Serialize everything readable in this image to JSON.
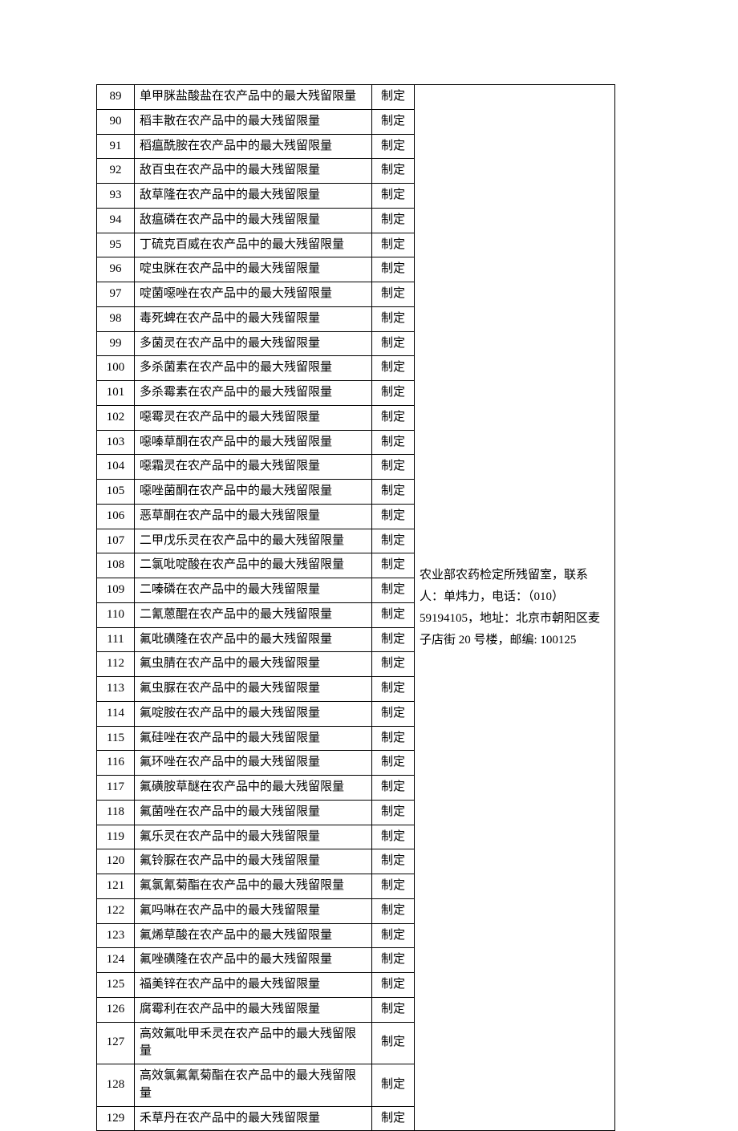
{
  "rows": [
    {
      "no": "89",
      "name": "单甲脒盐酸盐在农产品中的最大残留限量",
      "status": "制定"
    },
    {
      "no": "90",
      "name": "稻丰散在农产品中的最大残留限量",
      "status": "制定"
    },
    {
      "no": "91",
      "name": "稻瘟酰胺在农产品中的最大残留限量",
      "status": "制定"
    },
    {
      "no": "92",
      "name": "敌百虫在农产品中的最大残留限量",
      "status": "制定"
    },
    {
      "no": "93",
      "name": "敌草隆在农产品中的最大残留限量",
      "status": "制定"
    },
    {
      "no": "94",
      "name": "敌瘟磷在农产品中的最大残留限量",
      "status": "制定"
    },
    {
      "no": "95",
      "name": "丁硫克百威在农产品中的最大残留限量",
      "status": "制定"
    },
    {
      "no": "96",
      "name": "啶虫脒在农产品中的最大残留限量",
      "status": "制定"
    },
    {
      "no": "97",
      "name": "啶菌噁唑在农产品中的最大残留限量",
      "status": "制定"
    },
    {
      "no": "98",
      "name": "毒死蜱在农产品中的最大残留限量",
      "status": "制定"
    },
    {
      "no": "99",
      "name": "多菌灵在农产品中的最大残留限量",
      "status": "制定"
    },
    {
      "no": "100",
      "name": "多杀菌素在农产品中的最大残留限量",
      "status": "制定"
    },
    {
      "no": "101",
      "name": "多杀霉素在农产品中的最大残留限量",
      "status": "制定"
    },
    {
      "no": "102",
      "name": "噁霉灵在农产品中的最大残留限量",
      "status": "制定"
    },
    {
      "no": "103",
      "name": "噁嗪草酮在农产品中的最大残留限量",
      "status": "制定"
    },
    {
      "no": "104",
      "name": "噁霜灵在农产品中的最大残留限量",
      "status": "制定"
    },
    {
      "no": "105",
      "name": "噁唑菌酮在农产品中的最大残留限量",
      "status": "制定"
    },
    {
      "no": "106",
      "name": "恶草酮在农产品中的最大残留限量",
      "status": "制定"
    },
    {
      "no": "107",
      "name": "二甲戊乐灵在农产品中的最大残留限量",
      "status": "制定"
    },
    {
      "no": "108",
      "name": "二氯吡啶酸在农产品中的最大残留限量",
      "status": "制定"
    },
    {
      "no": "109",
      "name": "二嗪磷在农产品中的最大残留限量",
      "status": "制定"
    },
    {
      "no": "110",
      "name": "二氰蒽醌在农产品中的最大残留限量",
      "status": "制定"
    },
    {
      "no": "111",
      "name": "氟吡磺隆在农产品中的最大残留限量",
      "status": "制定"
    },
    {
      "no": "112",
      "name": "氟虫腈在农产品中的最大残留限量",
      "status": "制定"
    },
    {
      "no": "113",
      "name": "氟虫脲在农产品中的最大残留限量",
      "status": "制定"
    },
    {
      "no": "114",
      "name": "氟啶胺在农产品中的最大残留限量",
      "status": "制定"
    },
    {
      "no": "115",
      "name": "氟硅唑在农产品中的最大残留限量",
      "status": "制定"
    },
    {
      "no": "116",
      "name": "氟环唑在农产品中的最大残留限量",
      "status": "制定"
    },
    {
      "no": "117",
      "name": "氟磺胺草醚在农产品中的最大残留限量",
      "status": "制定"
    },
    {
      "no": "118",
      "name": "氟菌唑在农产品中的最大残留限量",
      "status": "制定"
    },
    {
      "no": "119",
      "name": "氟乐灵在农产品中的最大残留限量",
      "status": "制定"
    },
    {
      "no": "120",
      "name": "氟铃脲在农产品中的最大残留限量",
      "status": "制定"
    },
    {
      "no": "121",
      "name": "氟氯氰菊酯在农产品中的最大残留限量",
      "status": "制定"
    },
    {
      "no": "122",
      "name": "氟吗啉在农产品中的最大残留限量",
      "status": "制定"
    },
    {
      "no": "123",
      "name": "氟烯草酸在农产品中的最大残留限量",
      "status": "制定"
    },
    {
      "no": "124",
      "name": "氟唑磺隆在农产品中的最大残留限量",
      "status": "制定"
    },
    {
      "no": "125",
      "name": "福美锌在农产品中的最大残留限量",
      "status": "制定"
    },
    {
      "no": "126",
      "name": "腐霉利在农产品中的最大残留限量",
      "status": "制定"
    },
    {
      "no": "127",
      "name": "高效氟吡甲禾灵在农产品中的最大残留限量",
      "status": "制定"
    },
    {
      "no": "128",
      "name": "高效氯氟氰菊酯在农产品中的最大残留限量",
      "status": "制定"
    },
    {
      "no": "129",
      "name": "禾草丹在农产品中的最大残留限量",
      "status": "制定"
    }
  ],
  "contact": "农业部农药检定所残留室，联系人：单炜力，电话：（010）59194105，地址：北京市朝阳区麦子店街 20 号楼，邮编: 100125"
}
